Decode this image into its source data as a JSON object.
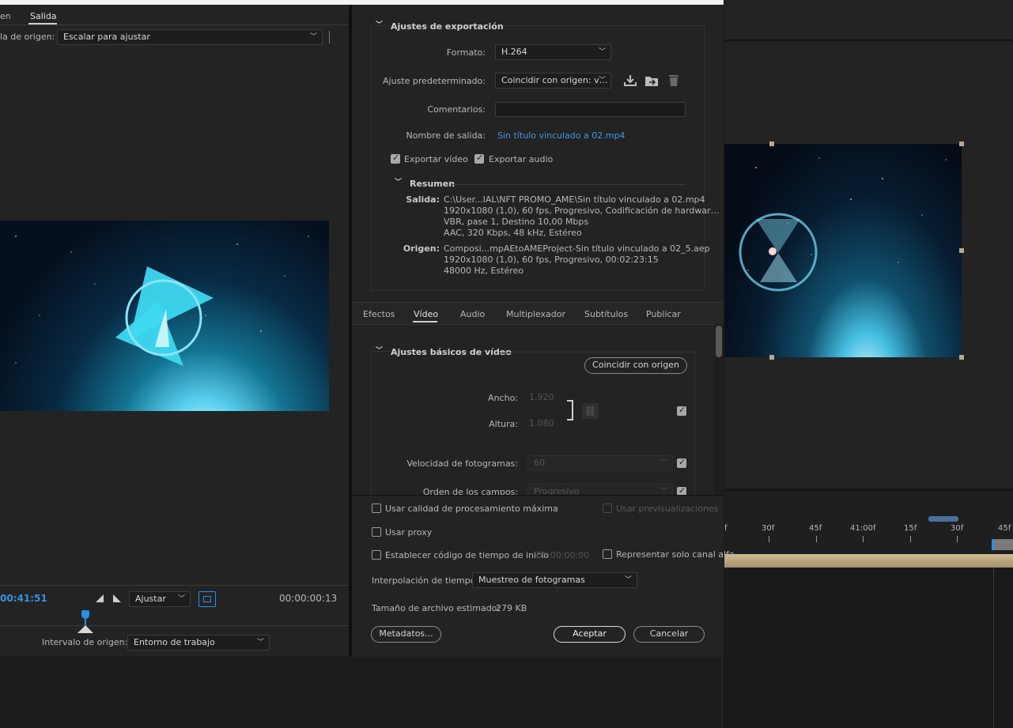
{
  "left_panel": {
    "tab_source": "en",
    "tab_output": "Salida",
    "scale_label": "la de origen:",
    "scale_value": "Escalar para ajustar",
    "current_time": "00:41:51",
    "fit_value": "Ajustar",
    "duration": "00:00:00:13",
    "range_label": "Intervalo de origen:",
    "range_value": "Entorno de trabajo"
  },
  "export_settings": {
    "title": "Ajustes de exportación",
    "format_label": "Formato:",
    "format_value": "H.264",
    "preset_label": "Ajuste predeterminado:",
    "preset_value": "Coincidir con origen: v…",
    "comments_label": "Comentarios:",
    "comments_value": "",
    "output_name_label": "Nombre de salida:",
    "output_name_value": "Sin título vinculado a 02.mp4",
    "export_video_label": "Exportar vídeo",
    "export_audio_label": "Exportar audio",
    "summary_title": "Resumen",
    "output_key": "Salida:",
    "output_lines": [
      "C:\\User...IAL\\NFT PROMO_AME\\Sin título vinculado a 02.mp4",
      "1920x1080 (1,0), 60 fps, Progresivo, Codificación de hardwar…",
      "VBR, pase 1, Destino 10,00 Mbps",
      "AAC, 320 Kbps, 48 kHz, Estéreo"
    ],
    "source_key": "Origen:",
    "source_lines": [
      "Composi...mpAEtoAMEProject-Sin título vinculado a 02_5.aep",
      "1920x1080 (1,0), 60 fps, Progresivo, 00:02:23:15",
      "48000 Hz, Estéreo"
    ]
  },
  "tabs": [
    "Efectos",
    "Vídeo",
    "Audio",
    "Multiplexador",
    "Subtítulos",
    "Publicar"
  ],
  "video_basic": {
    "title": "Ajustes básicos de vídeo",
    "match_button": "Coincidir con origen",
    "width_label": "Ancho:",
    "width_value": "1.920",
    "height_label": "Altura:",
    "height_value": "1.080",
    "fps_label": "Velocidad de fotogramas:",
    "fps_value": "60",
    "field_label": "Orden de los campos:",
    "field_value": "Progresivo"
  },
  "bottom": {
    "max_quality": "Usar calidad de procesamiento máxima",
    "use_previews": "Usar previsualizaciones",
    "use_proxy": "Usar proxy",
    "timecode": "Establecer código de tiempo de inicio",
    "timecode_value": "00:00:00:00",
    "alpha_only": "Representar solo canal alfa",
    "interp_label": "Interpolación de tiempo:",
    "interp_value": "Muestreo de fotogramas",
    "size_label": "Tamaño de archivo estimado:",
    "size_value": "279 KB",
    "metadata_button": "Metadatos...",
    "accept_button": "Aceptar",
    "cancel_button": "Cancelar"
  },
  "timeline_ruler": [
    "f",
    "30f",
    "45f",
    "41:00f",
    "15f",
    "30f",
    "45f"
  ]
}
